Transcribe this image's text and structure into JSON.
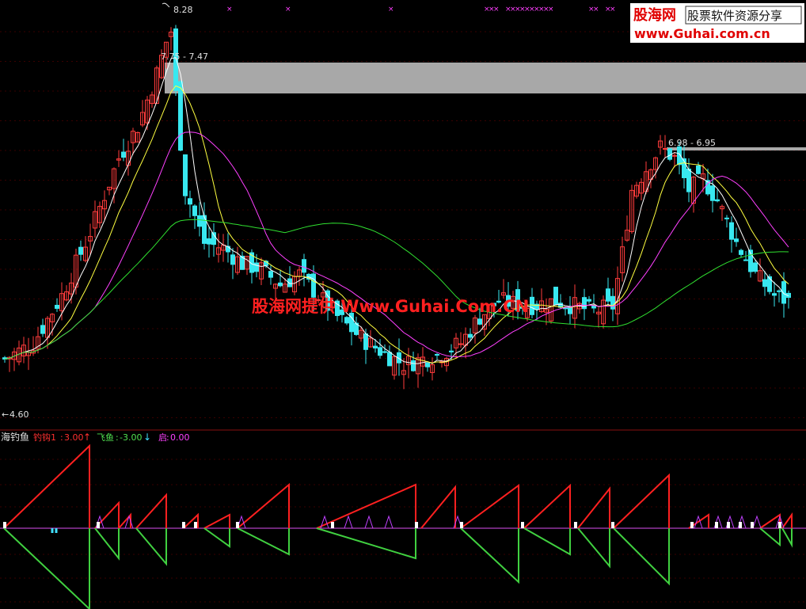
{
  "chart_data": [
    {
      "type": "candlestick",
      "annotations": {
        "high_label": "8.28",
        "low_label": "4.60",
        "zone1_label": "7.75 - 7.47",
        "zone2_label": "6.98 - 6.95"
      },
      "zones": [
        {
          "upper": 7.75,
          "lower": 7.47
        },
        {
          "upper": 6.98,
          "lower": 6.95
        }
      ],
      "ylim": [
        4.5,
        8.35
      ],
      "watermark": "股海网提供 Www.Guhai.Com.CN",
      "colors": {
        "up": "#ff3c3c",
        "down": "#38e8f0",
        "ma5": "#ffffff",
        "ma10": "#ffff40",
        "ma20": "#ff40ff",
        "ma60": "#30e030",
        "zone": "#a8a8a8"
      }
    },
    {
      "type": "line",
      "title": "海钓鱼",
      "series": [
        {
          "name": "钓钩1",
          "value_label": "3.00",
          "arrow": "↑",
          "color": "#ff3030"
        },
        {
          "name": "飞鱼",
          "value_label": "-3.00",
          "arrow": "↓",
          "color": "#50e050"
        },
        {
          "name": "启",
          "value_label": "0.00",
          "arrow": "",
          "color": "#ff40ff"
        }
      ],
      "ylim": [
        -3,
        3
      ]
    }
  ],
  "logo": {
    "name": "股海网",
    "slogan": "股票软件资源分享",
    "url": "www.Guhai.com.cn"
  }
}
